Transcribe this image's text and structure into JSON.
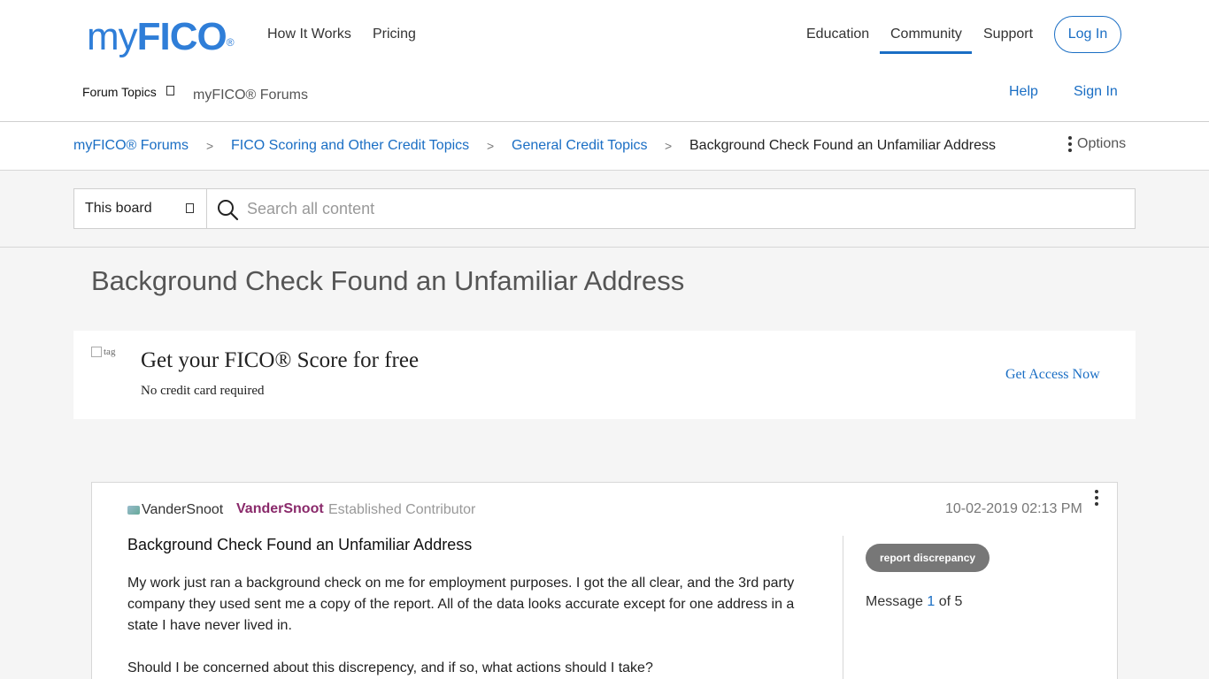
{
  "header": {
    "logo": {
      "my": "my",
      "fico": "FICO",
      "reg": "®"
    },
    "nav_left": [
      "How It Works",
      "Pricing"
    ],
    "nav_right": [
      "Education",
      "Community",
      "Support"
    ],
    "login": "Log In",
    "forum_topics": "Forum Topics",
    "forums_home": "myFICO® Forums",
    "help": "Help",
    "sign_in": "Sign In"
  },
  "breadcrumb": {
    "items": [
      "myFICO® Forums",
      "FICO Scoring and Other Credit Topics",
      "General Credit Topics"
    ],
    "separator": ">",
    "current": "Background Check Found an Unfamiliar Address",
    "options": "Options"
  },
  "search": {
    "scope": "This board",
    "placeholder": "Search all content"
  },
  "page_title": "Background Check Found an Unfamiliar Address",
  "promo": {
    "img_alt": "tag",
    "title": "Get your FICO® Score for free",
    "subtitle": "No credit card required",
    "cta": "Get Access Now"
  },
  "post": {
    "avatar_alt": "VanderSnoot",
    "author": "VanderSnoot",
    "rank": "Established Contributor",
    "date": "10-02-2019",
    "time": "02:13 PM",
    "subject": "Background Check Found an Unfamiliar Address",
    "body": [
      "My work just ran a background check on me for employment purposes. I got the all clear, and the 3rd party company they used sent me a copy of the report. All of the data looks accurate except for one address in a state I have never lived in.",
      "Should I be concerned about this discrepency, and if so, what actions should I take?"
    ],
    "tag": "report discrepancy",
    "message_label": "Message",
    "message_num": "1",
    "message_of": "of 5"
  },
  "colors": {
    "brand_blue": "#2f7ed8",
    "link_blue": "#1a6ec4",
    "author_purple": "#8a2a6b",
    "tag_grey": "#777777"
  }
}
